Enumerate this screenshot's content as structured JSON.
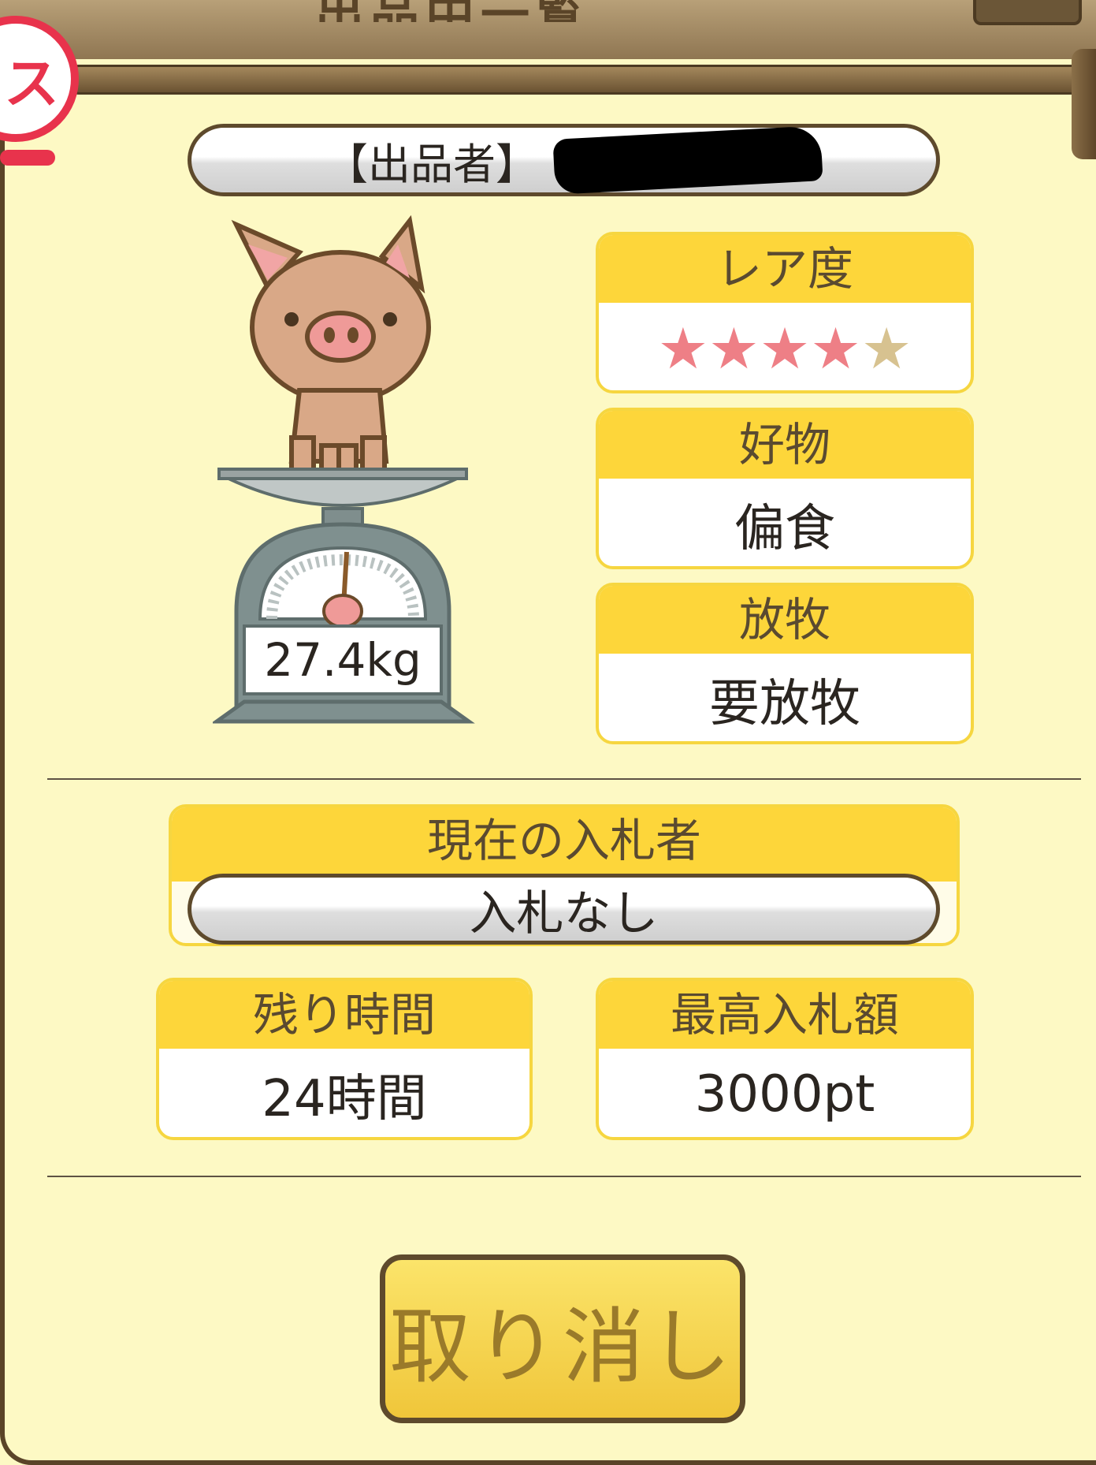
{
  "header": {
    "title_partial": "出品中一覧"
  },
  "stamp": {
    "text": "ス"
  },
  "seller": {
    "label": "【出品者】"
  },
  "item": {
    "weight": "27.4kg"
  },
  "rarity": {
    "label": "レア度",
    "stars_filled": 4,
    "stars_total": 5,
    "star_color": "#ee7f86",
    "star_empty_color": "#d7c290"
  },
  "favorite": {
    "label": "好物",
    "value": "偏食"
  },
  "grazing": {
    "label": "放牧",
    "value": "要放牧"
  },
  "current_bidder": {
    "label": "現在の入札者",
    "value": "入札なし"
  },
  "time_left": {
    "label": "残り時間",
    "value": "24時間"
  },
  "highest_bid": {
    "label": "最高入札額",
    "value": "3000pt"
  },
  "actions": {
    "cancel_label": "取り消し"
  },
  "colors": {
    "background": "#fdf9c4",
    "card_header": "#fdd63a",
    "button": "#f6d347",
    "border_brown": "#5e4a2c"
  }
}
